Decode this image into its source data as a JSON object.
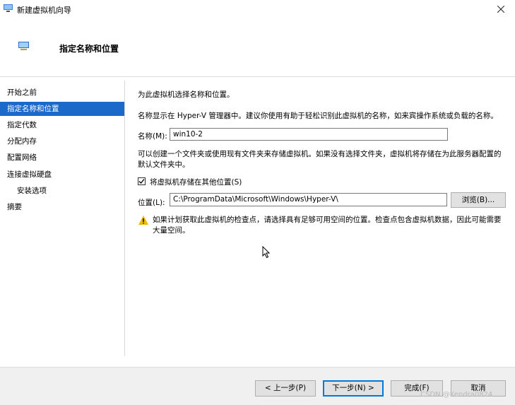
{
  "window": {
    "title": "新建虚拟机向导"
  },
  "header": {
    "title": "指定名称和位置"
  },
  "sidebar": {
    "items": [
      {
        "label": "开始之前"
      },
      {
        "label": "指定名称和位置"
      },
      {
        "label": "指定代数"
      },
      {
        "label": "分配内存"
      },
      {
        "label": "配置网络"
      },
      {
        "label": "连接虚拟硬盘"
      },
      {
        "label": "安装选项"
      },
      {
        "label": "摘要"
      }
    ]
  },
  "main": {
    "intro": "为此虚拟机选择名称和位置。",
    "name_hint": "名称显示在 Hyper-V 管理器中。建议你使用有助于轻松识别此虚拟机的名称，如来宾操作系统或负载的名称。",
    "name_label": "名称(M):",
    "name_value": "win10-2",
    "folder_hint": "可以创建一个文件夹或使用现有文件夹来存储虚拟机。如果没有选择文件夹，虚拟机将存储在为此服务器配置的默认文件夹中。",
    "store_checkbox_label": "将虚拟机存储在其他位置(S)",
    "store_checked": true,
    "location_label": "位置(L):",
    "location_value": "C:\\ProgramData\\Microsoft\\Windows\\Hyper-V\\",
    "browse_label": "浏览(B)...",
    "warning": "如果计划获取此虚拟机的检查点，请选择具有足够可用空间的位置。检查点包含虚拟机数据，因此可能需要大量空间。"
  },
  "footer": {
    "prev_label": "< 上一步(P)",
    "next_label": "下一步(N) >",
    "finish_label": "完成(F)",
    "cancel_label": "取消",
    "watermark": "CSDN @Kendra0824"
  },
  "colors": {
    "accent": "#1b6ac9",
    "warning": "#f2b705"
  }
}
